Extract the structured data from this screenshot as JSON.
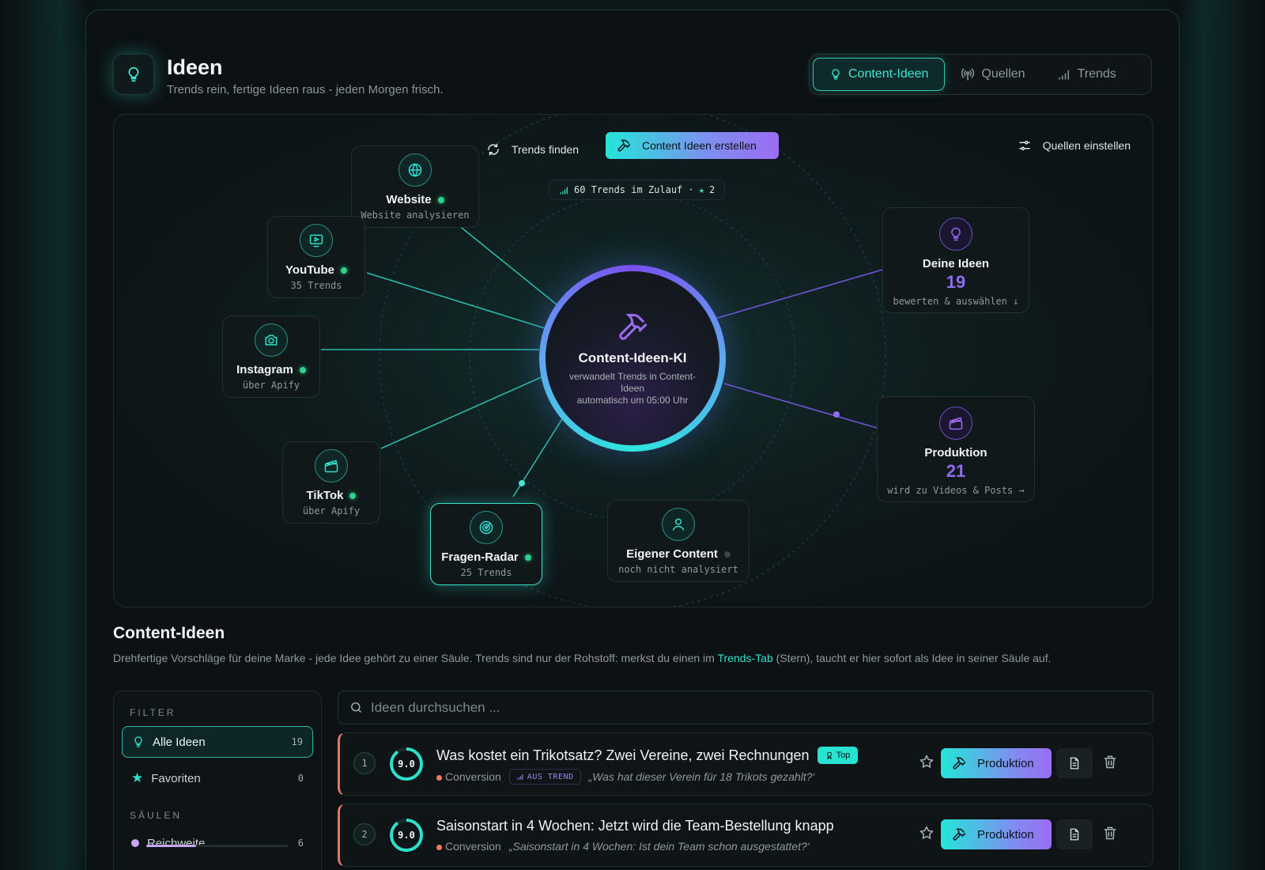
{
  "header": {
    "title": "Ideen",
    "subtitle": "Trends rein, fertige Ideen raus - jeden Morgen frisch.",
    "tabs": [
      {
        "label": "Content-Ideen",
        "icon": "lightbulb-icon",
        "active": true
      },
      {
        "label": "Quellen",
        "icon": "broadcast-icon",
        "active": false
      },
      {
        "label": "Trends",
        "icon": "signal-bars-icon",
        "active": false
      }
    ]
  },
  "hub": {
    "actions": {
      "find_trends": "Trends finden",
      "create_ideas": "Content Ideen erstellen",
      "configure_sources": "Quellen einstellen"
    },
    "trend_chip": {
      "text": "60 Trends im Zulauf ·",
      "starred": "2"
    },
    "core": {
      "title": "Content-Ideen-KI",
      "subtitle": "verwandelt Trends in Content-Ideen",
      "schedule": "automatisch um 05:00 Uhr"
    },
    "sources": {
      "website": {
        "name": "Website",
        "sub": "Website analysieren"
      },
      "youtube": {
        "name": "YouTube",
        "sub": "35 Trends"
      },
      "instagram": {
        "name": "Instagram",
        "sub": "über Apify"
      },
      "tiktok": {
        "name": "TikTok",
        "sub": "über Apify"
      },
      "radar": {
        "name": "Fragen-Radar",
        "sub": "25 Trends"
      },
      "own": {
        "name": "Eigener Content",
        "sub": "noch nicht analysiert"
      }
    },
    "outputs": {
      "ideas": {
        "name": "Deine Ideen",
        "count": "19",
        "sub": "bewerten & auswählen ↓"
      },
      "production": {
        "name": "Produktion",
        "count": "21",
        "sub": "wird zu Videos & Posts →"
      }
    }
  },
  "content": {
    "title": "Content-Ideen",
    "desc_before": "Drehfertige Vorschläge für deine Marke - jede Idee gehört zu einer Säule. Trends sind nur der Rohstoff: merkst du einen im ",
    "desc_link": "Trends-Tab",
    "desc_after": " (Stern), taucht er hier sofort als Idee in seiner Säule auf."
  },
  "filter": {
    "heading": "FILTER",
    "all": {
      "label": "Alle Ideen",
      "count": "19"
    },
    "favorites": {
      "label": "Favoriten",
      "count": "0"
    },
    "pillars_heading": "SÄULEN",
    "pillars": [
      {
        "label": "Reichweite",
        "count": "6",
        "share": 0.35,
        "color": "#c9a5f5"
      }
    ]
  },
  "search": {
    "placeholder": "Ideen durchsuchen ..."
  },
  "ideas": [
    {
      "rank": "1",
      "score": "9.0",
      "title": "Was kostet ein Trikotsatz? Zwei Vereine, zwei Rechnungen",
      "badge": "Top",
      "category": "Conversion",
      "trend_tag": "AUS TREND",
      "quote": "„Was hat dieser Verein für 18 Trikots gezahlt?‘",
      "action": "Produktion"
    },
    {
      "rank": "2",
      "score": "9.0",
      "title": "Saisonstart in 4 Wochen: Jetzt wird die Team-Bestellung knapp",
      "badge": "",
      "category": "Conversion",
      "trend_tag": "",
      "quote": "„Saisonstart in 4 Wochen: Ist dein Team schon ausgestattet?‘",
      "action": "Produktion"
    }
  ],
  "colors": {
    "accent": "#2ee0cc",
    "purple": "#8f6cf2",
    "conversion": "#ef7d5a"
  }
}
